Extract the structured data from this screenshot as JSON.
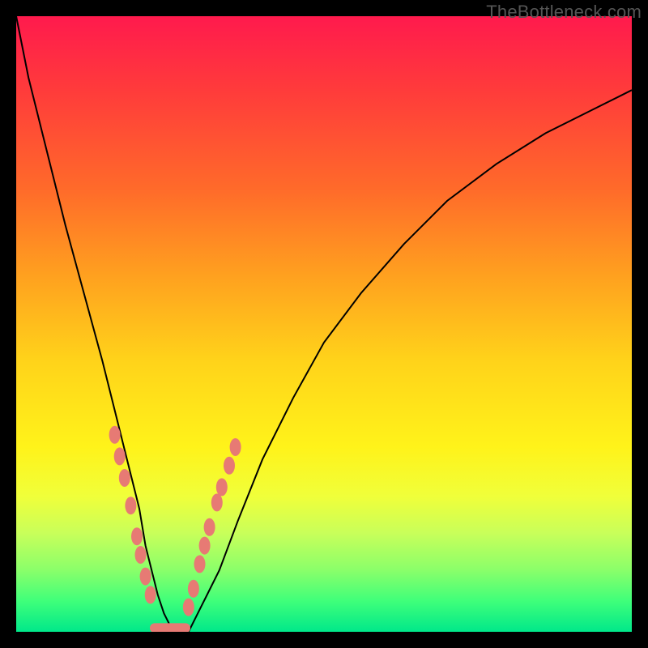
{
  "watermark": "TheBottleneck.com",
  "chart_data": {
    "type": "line",
    "title": "",
    "xlabel": "",
    "ylabel": "",
    "xlim": [
      0,
      100
    ],
    "ylim": [
      0,
      100
    ],
    "grid": false,
    "legend": false,
    "series": [
      {
        "name": "bottleneck-curve",
        "kind": "curve",
        "x": [
          0,
          2,
          5,
          8,
          11,
          14,
          16,
          18,
          20,
          21,
          22,
          23,
          24,
          25,
          26,
          28,
          30,
          33,
          36,
          40,
          45,
          50,
          56,
          63,
          70,
          78,
          86,
          94,
          100
        ],
        "y": [
          100,
          90,
          78,
          66,
          55,
          44,
          36,
          28,
          20,
          14,
          10,
          6,
          3,
          1,
          0,
          0,
          4,
          10,
          18,
          28,
          38,
          47,
          55,
          63,
          70,
          76,
          81,
          85,
          88
        ]
      },
      {
        "name": "left-branch-markers",
        "kind": "markers",
        "points": [
          {
            "x": 16.0,
            "y": 32.0
          },
          {
            "x": 16.8,
            "y": 28.5
          },
          {
            "x": 17.6,
            "y": 25.0
          },
          {
            "x": 18.6,
            "y": 20.5
          },
          {
            "x": 19.6,
            "y": 15.5
          },
          {
            "x": 20.2,
            "y": 12.5
          },
          {
            "x": 21.0,
            "y": 9.0
          },
          {
            "x": 21.8,
            "y": 6.0
          }
        ]
      },
      {
        "name": "right-branch-markers",
        "kind": "markers",
        "points": [
          {
            "x": 28.0,
            "y": 4.0
          },
          {
            "x": 28.8,
            "y": 7.0
          },
          {
            "x": 29.8,
            "y": 11.0
          },
          {
            "x": 30.6,
            "y": 14.0
          },
          {
            "x": 31.4,
            "y": 17.0
          },
          {
            "x": 32.6,
            "y": 21.0
          },
          {
            "x": 33.4,
            "y": 23.5
          },
          {
            "x": 34.6,
            "y": 27.0
          },
          {
            "x": 35.6,
            "y": 30.0
          }
        ]
      },
      {
        "name": "valley-floor",
        "kind": "flat-segment",
        "x0": 22.5,
        "x1": 27.5,
        "y": 0.6
      }
    ],
    "background_gradient": {
      "top": "#ff1a4d",
      "mid": "#fff31a",
      "bottom": "#00e88a"
    }
  }
}
